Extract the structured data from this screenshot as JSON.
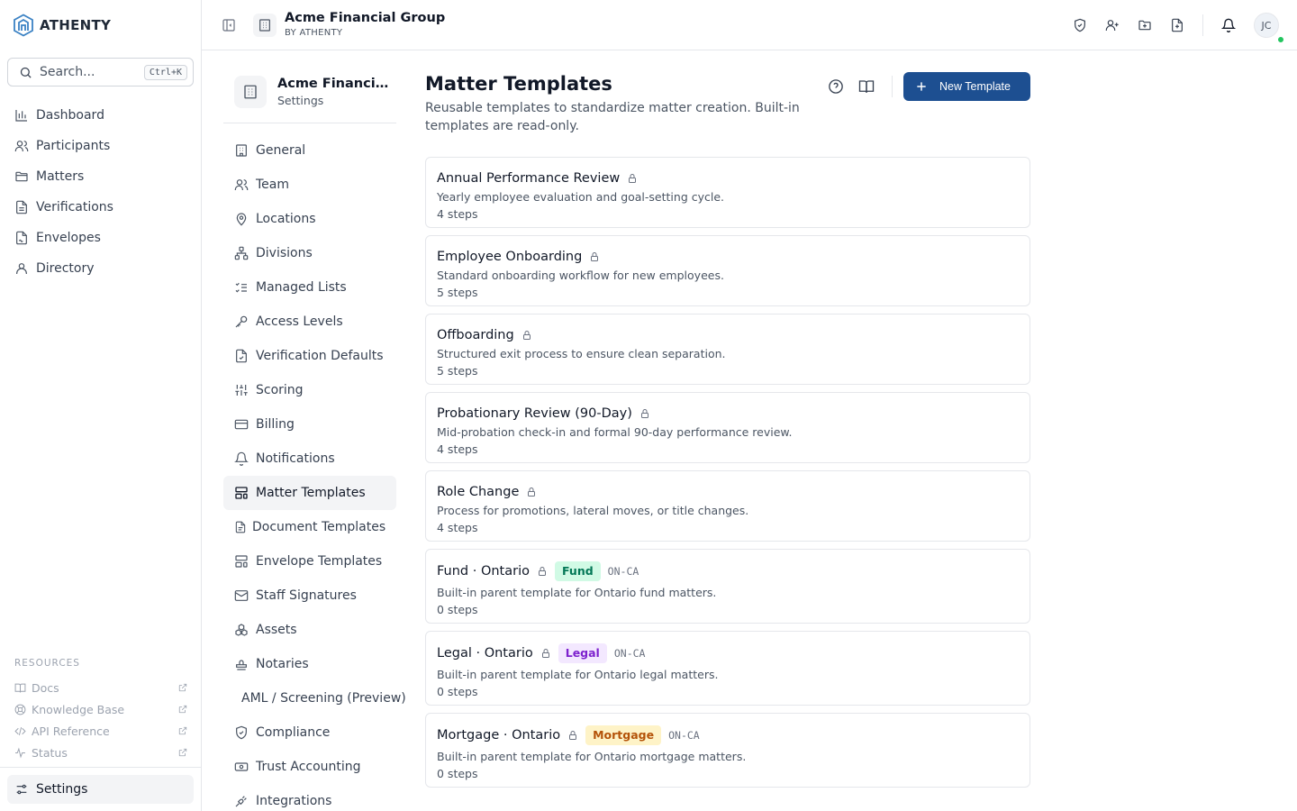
{
  "app": {
    "logo_text": "ATHENTY",
    "search": {
      "placeholder": "Search...",
      "shortcut": "Ctrl+K"
    },
    "nav": [
      {
        "label": "Dashboard",
        "icon": "bar-chart-icon"
      },
      {
        "label": "Participants",
        "icon": "users-icon"
      },
      {
        "label": "Matters",
        "icon": "folder-icon"
      },
      {
        "label": "Verifications",
        "icon": "file-text-icon"
      },
      {
        "label": "Envelopes",
        "icon": "file-signature-icon"
      },
      {
        "label": "Directory",
        "icon": "user-icon"
      }
    ],
    "resources_title": "RESOURCES",
    "resources": [
      {
        "label": "Docs",
        "icon": "book-icon"
      },
      {
        "label": "Knowledge Base",
        "icon": "lifebuoy-icon"
      },
      {
        "label": "API Reference",
        "icon": "code-icon"
      },
      {
        "label": "Status",
        "icon": "activity-icon"
      }
    ],
    "settings_label": "Settings"
  },
  "header": {
    "org_name": "Acme Financial Group",
    "org_sub": "BY ATHENTY",
    "avatar_initials": "JC",
    "icons": [
      "shield-check-icon",
      "user-plus-icon",
      "folder-plus-icon",
      "file-plus-icon",
      "bell-icon"
    ]
  },
  "settings": {
    "org_name": "Acme Financial Group",
    "org_sub": "Settings",
    "items": [
      {
        "label": "General",
        "icon": "building-icon"
      },
      {
        "label": "Team",
        "icon": "users-icon"
      },
      {
        "label": "Locations",
        "icon": "map-pin-icon"
      },
      {
        "label": "Divisions",
        "icon": "network-icon"
      },
      {
        "label": "Managed Lists",
        "icon": "list-checks-icon"
      },
      {
        "label": "Access Levels",
        "icon": "key-icon"
      },
      {
        "label": "Verification Defaults",
        "icon": "file-check-icon"
      },
      {
        "label": "Scoring",
        "icon": "sliders-icon"
      },
      {
        "label": "Billing",
        "icon": "credit-card-icon"
      },
      {
        "label": "Notifications",
        "icon": "bell-icon"
      },
      {
        "label": "Matter Templates",
        "icon": "layout-template-icon",
        "active": true
      },
      {
        "label": "Document Templates",
        "icon": "file-icon"
      },
      {
        "label": "Envelope Templates",
        "icon": "layout-template-icon"
      },
      {
        "label": "Staff Signatures",
        "icon": "mail-icon"
      },
      {
        "label": "Assets",
        "icon": "boxes-icon"
      },
      {
        "label": "Notaries",
        "icon": "stamp-icon"
      },
      {
        "label": "AML / Screening (Preview)",
        "icon": ""
      },
      {
        "label": "Compliance",
        "icon": "shield-icon"
      },
      {
        "label": "Trust Accounting",
        "icon": "banknote-icon"
      },
      {
        "label": "Integrations",
        "icon": "plug-icon"
      }
    ]
  },
  "main": {
    "title": "Matter Templates",
    "description": "Reusable templates to standardize matter creation. Built-in templates are read-only.",
    "new_button": "New Template",
    "templates": [
      {
        "name": "Annual Performance Review",
        "description": "Yearly employee evaluation and goal-setting cycle.",
        "steps": "4 steps"
      },
      {
        "name": "Employee Onboarding",
        "description": "Standard onboarding workflow for new employees.",
        "steps": "5 steps"
      },
      {
        "name": "Offboarding",
        "description": "Structured exit process to ensure clean separation.",
        "steps": "5 steps"
      },
      {
        "name": "Probationary Review (90-Day)",
        "description": "Mid-probation check-in and formal 90-day performance review.",
        "steps": "4 steps"
      },
      {
        "name": "Role Change",
        "description": "Process for promotions, lateral moves, or title changes.",
        "steps": "4 steps"
      },
      {
        "name": "Fund · Ontario",
        "badge": "Fund",
        "badge_bg": "#d1fae5",
        "badge_fg": "#047857",
        "code": "ON-CA",
        "description": "Built-in parent template for Ontario fund matters.",
        "steps": "0 steps"
      },
      {
        "name": "Legal · Ontario",
        "badge": "Legal",
        "badge_bg": "#f3e8ff",
        "badge_fg": "#7e22ce",
        "code": "ON-CA",
        "description": "Built-in parent template for Ontario legal matters.",
        "steps": "0 steps"
      },
      {
        "name": "Mortgage · Ontario",
        "badge": "Mortgage",
        "badge_bg": "#fef3c7",
        "badge_fg": "#b45309",
        "code": "ON-CA",
        "description": "Built-in parent template for Ontario mortgage matters.",
        "steps": "0 steps"
      }
    ]
  },
  "colors": {
    "primary": "#1d4f91",
    "online": "#22c55e",
    "logo": "#3b82c4"
  }
}
